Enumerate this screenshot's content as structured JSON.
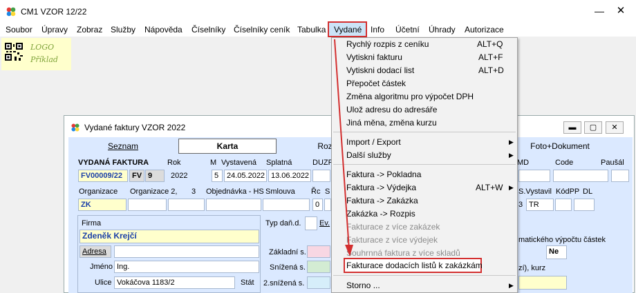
{
  "window": {
    "title": "CM1 VZOR 12/22",
    "minimize": "—",
    "close": "✕"
  },
  "menubar": [
    {
      "label": "Soubor"
    },
    {
      "label": "Úpravy"
    },
    {
      "label": "Zobraz"
    },
    {
      "label": "Služby"
    },
    {
      "label": "Nápověda"
    },
    {
      "label": "Číselníky"
    },
    {
      "label": "Číselníky ceník"
    },
    {
      "label": "Tabulka"
    },
    {
      "label": "Vydané"
    },
    {
      "label": "Info"
    },
    {
      "label": "Účetní"
    },
    {
      "label": "Úhrady"
    },
    {
      "label": "Autorizace"
    }
  ],
  "logo": {
    "line1": "LOGO",
    "line2": "Příklad"
  },
  "inner_window": {
    "title": "Vydané faktury VZOR  2022",
    "tabs": {
      "seznam": "Seznam",
      "karta": "Karta",
      "roz": "Roz",
      "foto": "Foto+Dokument"
    },
    "header": {
      "vydana_faktura": "VYDANÁ FAKTURA",
      "rok_label": "Rok",
      "m_label": "M",
      "vystavena_label": "Vystavená",
      "splatna_label": "Splatná",
      "duzp_label": "DUZP",
      "cislo": "FV00009/22",
      "rada": "FV",
      "rada_num": "9",
      "rok": "2022",
      "m": "5",
      "vystavena": "24.05.2022",
      "splatna": "13.06.2022",
      "md_label": "MD",
      "code_label": "Code",
      "pausal_label": "Paušál"
    },
    "row2": {
      "organizace_label": "Organizace",
      "organizace2_label": "Organizace  2,",
      "three": "3",
      "objednavka_label": "Objednávka - HS",
      "smlouva_label": "Smlouva",
      "rc_label": "Řc",
      "s_label": "S",
      "org_value": "ZK",
      "zero": "0",
      "vystavil_label": "S.Vystavil",
      "kodpp_label": "KódPP",
      "dl_label": "DL",
      "num3": "3",
      "tr": "TR"
    },
    "firma": {
      "firma_label": "Firma",
      "firma_value": "Zdeněk Krejčí",
      "adresa_btn": "Adresa",
      "jmeno_label": "Jméno",
      "jmeno_value": "Ing.",
      "ulice_label": "Ulice",
      "ulice_value": "Vokáčova 1183/2",
      "stat_label": "Stát",
      "typ_dan_label": "Typ daň.d.",
      "ev_label": "Ev.",
      "zakladni_label": "Základní s.",
      "snizena_label": "Snížená s.",
      "snizena2_label": "2.snížená s.",
      "auto_label": "matického výpočtu částek",
      "ne": "Ne",
      "kurz_label": "zí), kurz"
    }
  },
  "dropdown": {
    "items": [
      {
        "label": "Rychlý rozpis z ceníku",
        "shortcut": "ALT+Q"
      },
      {
        "label": "Vytiskni fakturu",
        "shortcut": "ALT+F"
      },
      {
        "label": "Vytiskni dodací list",
        "shortcut": "ALT+D"
      },
      {
        "label": "Přepočet  částek",
        "shortcut": ""
      },
      {
        "label": "Změna algoritmu pro výpočet DPH",
        "shortcut": ""
      },
      {
        "label": "Ulož adresu do adresáře",
        "shortcut": ""
      },
      {
        "label": "Jiná měna, změna kurzu",
        "shortcut": ""
      },
      {
        "label": "Import / Export",
        "shortcut": ""
      },
      {
        "label": "Další služby",
        "shortcut": ""
      },
      {
        "label": "Faktura -> Pokladna",
        "shortcut": ""
      },
      {
        "label": "Faktura -> Výdejka",
        "shortcut": "ALT+W"
      },
      {
        "label": "Faktura -> Zakázka",
        "shortcut": ""
      },
      {
        "label": "Zakázka -> Rozpis",
        "shortcut": ""
      },
      {
        "label": "Fakturace z více zakázek",
        "shortcut": ""
      },
      {
        "label": "Fakturace z více výdejek",
        "shortcut": ""
      },
      {
        "label": "Souhrnná faktura z více skladů",
        "shortcut": ""
      },
      {
        "label": "Fakturace dodacích listů k zakázkám",
        "shortcut": ""
      },
      {
        "label": "Storno ...",
        "shortcut": ""
      }
    ]
  },
  "colors": {
    "highlight": "#d32f2f",
    "form_bg": "#dbe9ff",
    "yellow_field": "#ffffcc",
    "field_blue": "#1a3fa8"
  }
}
